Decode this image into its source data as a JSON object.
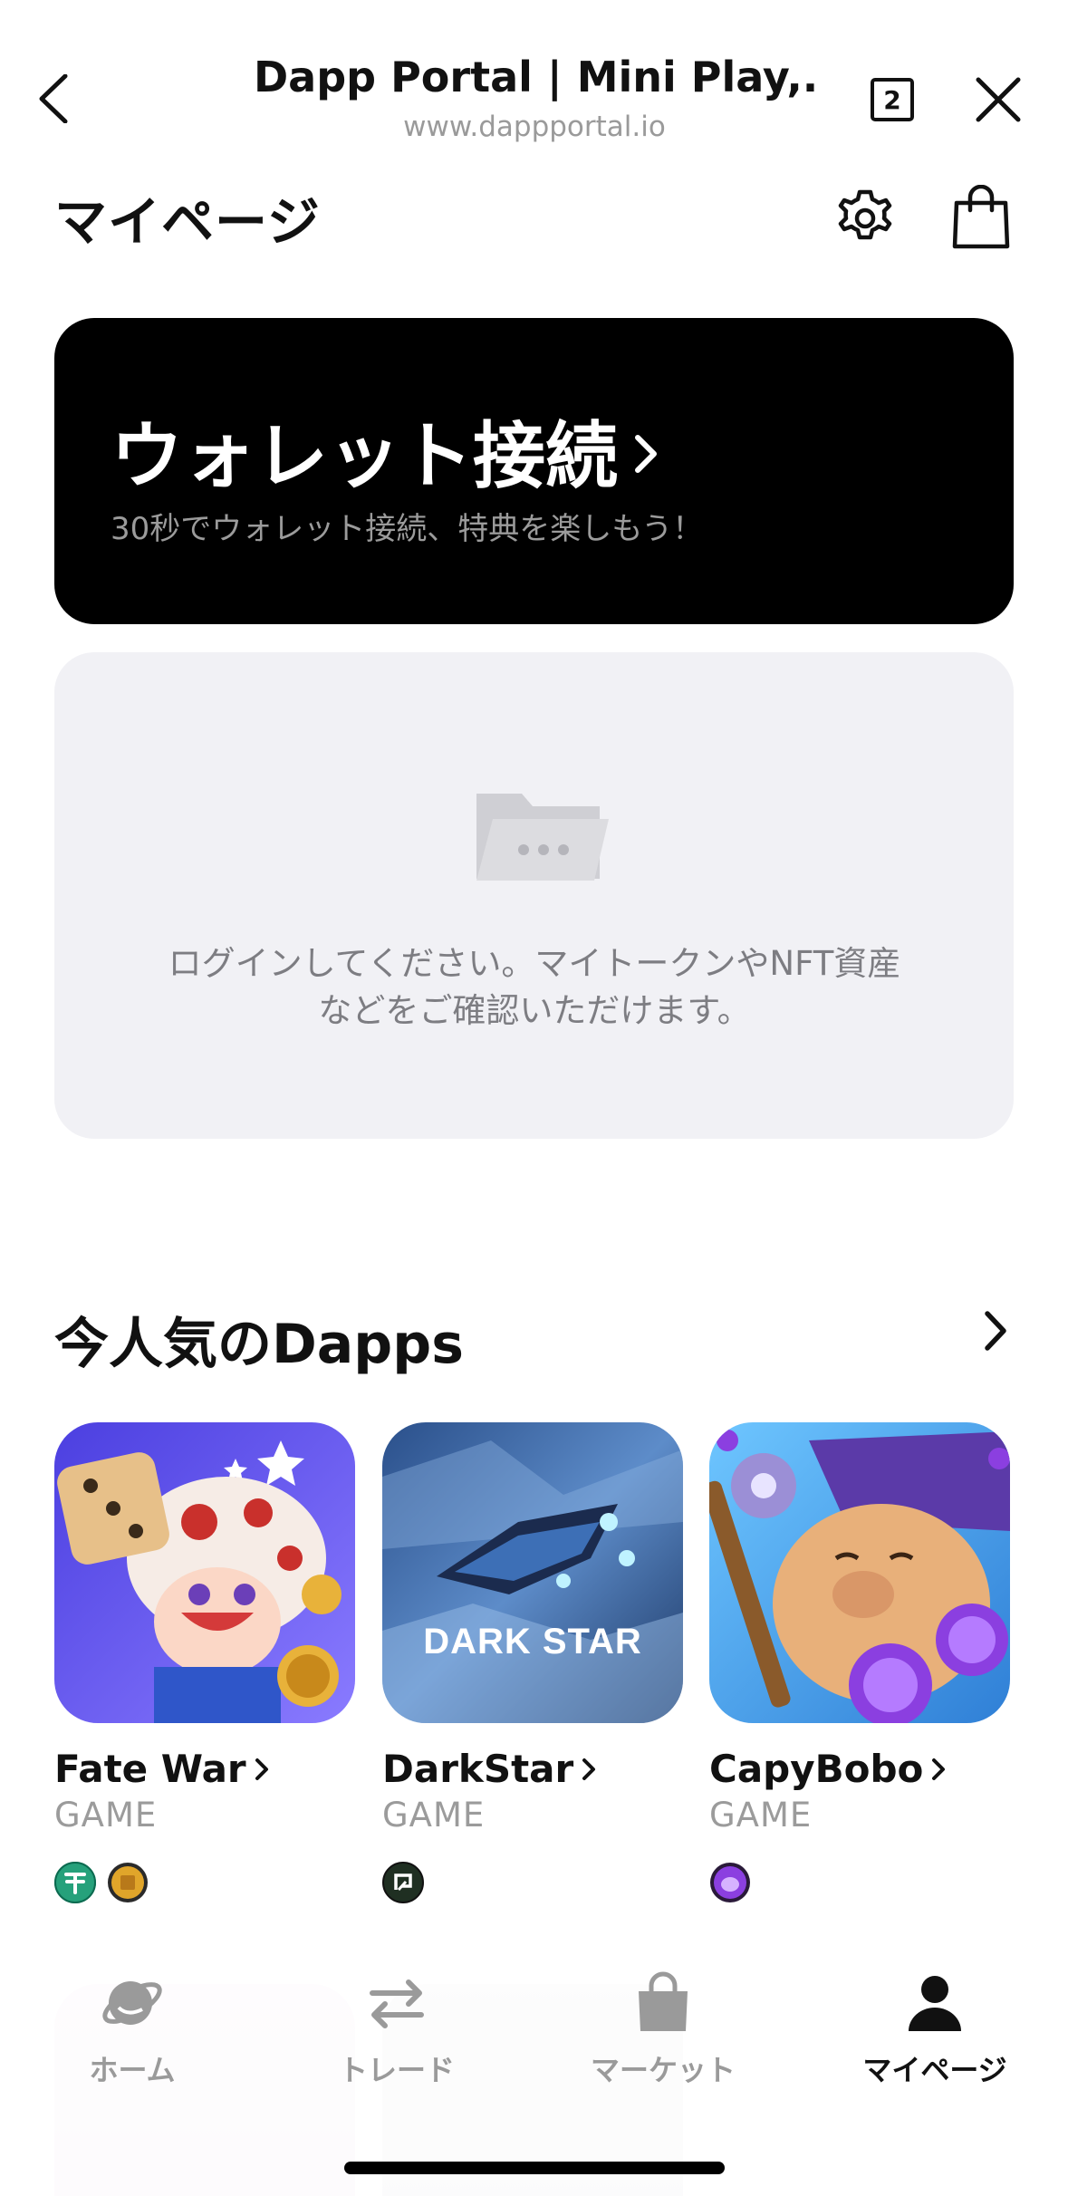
{
  "browser": {
    "title": "Dapp Portal | Mini Play,...",
    "url": "www.dappportal.io",
    "tab_count": "2"
  },
  "page": {
    "title": "マイページ"
  },
  "wallet_card": {
    "title": "ウォレット接続",
    "subtitle": "30秒でウォレット接続、特典を楽しもう！"
  },
  "login_card": {
    "message_line1": "ログインしてください。マイトークンやNFT資産",
    "message_line2": "などをご確認いただけます。"
  },
  "popular": {
    "title": "今人気のDapps",
    "apps": [
      {
        "name": "Fate War",
        "category": "GAME",
        "tokens": [
          "tether-token-icon",
          "gold-coin-token-icon"
        ]
      },
      {
        "name": "DarkStar",
        "category": "GAME",
        "tokens": [
          "darkstar-token-icon"
        ],
        "logo_text": "DARK STAR"
      },
      {
        "name": "CapyBobo",
        "category": "GAME",
        "tokens": [
          "capybobo-token-icon"
        ]
      }
    ]
  },
  "bottom_nav": {
    "items": [
      {
        "label": "ホーム",
        "icon": "home-planet-icon",
        "active": false
      },
      {
        "label": "トレード",
        "icon": "swap-arrows-icon",
        "active": false
      },
      {
        "label": "マーケット",
        "icon": "shopping-bag-icon",
        "active": false
      },
      {
        "label": "マイページ",
        "icon": "person-icon",
        "active": true
      }
    ]
  },
  "colors": {
    "wallet_card_bg": "#000000",
    "login_card_bg": "#F1F1F5",
    "muted_text": "#9B9B9B",
    "tether_green": "#26A17B",
    "capy_purple": "#8B3FE0"
  }
}
